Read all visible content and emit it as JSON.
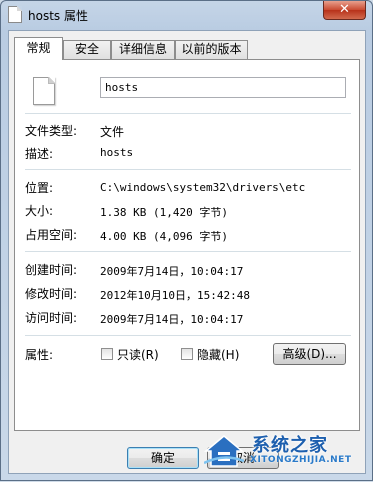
{
  "window": {
    "title": "hosts 属性",
    "close_label": "✕"
  },
  "tabs": [
    {
      "label": "常规"
    },
    {
      "label": "安全"
    },
    {
      "label": "详细信息"
    },
    {
      "label": "以前的版本"
    }
  ],
  "general": {
    "file_name": "hosts",
    "file_type_label": "文件类型:",
    "file_type_value": "文件",
    "description_label": "描述:",
    "description_value": "hosts",
    "location_label": "位置:",
    "location_value": "C:\\windows\\system32\\drivers\\etc",
    "size_label": "大小:",
    "size_value": "1.38 KB (1,420 字节)",
    "size_on_disk_label": "占用空间:",
    "size_on_disk_value": "4.00 KB (4,096 字节)",
    "created_label": "创建时间:",
    "created_value": "2009年7月14日，10:04:17",
    "modified_label": "修改时间:",
    "modified_value": "2012年10月10日，15:42:48",
    "accessed_label": "访问时间:",
    "accessed_value": "2009年7月14日，10:04:17",
    "attributes_label": "属性:",
    "readonly_label": "只读(R)",
    "hidden_label": "隐藏(H)",
    "advanced_label": "高级(D)..."
  },
  "footer": {
    "ok_label": "确定",
    "cancel_label": "取消"
  },
  "watermark": {
    "brand": "系统之家",
    "url": "XITONGZHIJIA.NET"
  },
  "colors": {
    "frame": "#c5d5e7",
    "close": "#c94a31",
    "brand": "#1d5fae"
  }
}
